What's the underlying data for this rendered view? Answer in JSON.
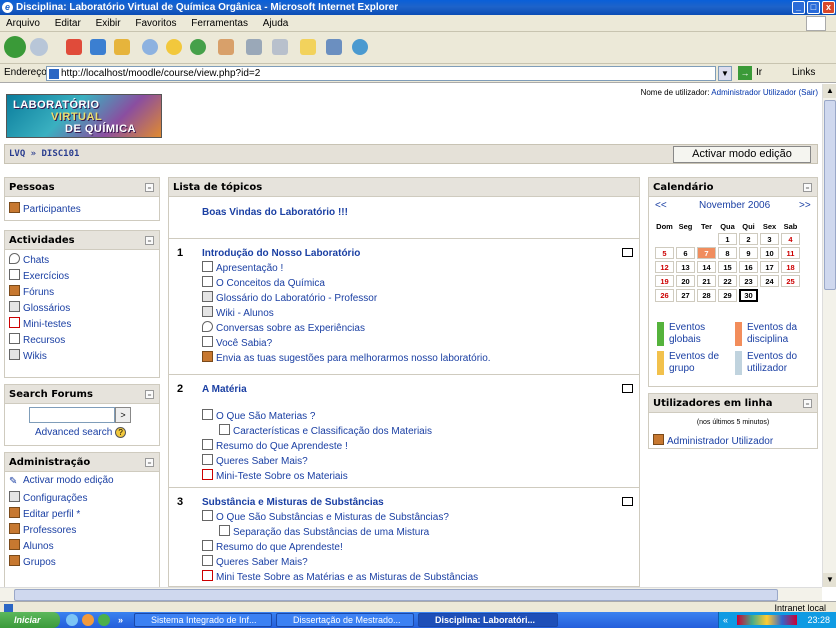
{
  "window": {
    "title": "Disciplina: Laboratório Virtual de Química Orgânica - Microsoft Internet Explorer"
  },
  "menu": [
    "Arquivo",
    "Editar",
    "Exibir",
    "Favoritos",
    "Ferramentas",
    "Ajuda"
  ],
  "address": {
    "label": "Endereço",
    "url": "http://localhost/moodle/course/view.php?id=2",
    "go": "Ir",
    "links": "Links"
  },
  "logo": {
    "line1": "LABORATÓRIO",
    "line2": "VIRTUAL",
    "line3": "DE QUÍMICA"
  },
  "login": {
    "prefix": "Nome de utilizador:",
    "user": "Administrador Utilizador",
    "logout": "(Sair)"
  },
  "nav": {
    "crumb": "LVQ » DISC101",
    "edit_button": "Activar modo edição"
  },
  "pessoas": {
    "title": "Pessoas",
    "items": [
      "Participantes"
    ]
  },
  "actividades": {
    "title": "Actividades",
    "items": [
      "Chats",
      "Exercícios",
      "Fóruns",
      "Glossários",
      "Mini-testes",
      "Recursos",
      "Wikis"
    ]
  },
  "search": {
    "title": "Search Forums",
    "button": ">",
    "advanced": "Advanced search"
  },
  "admin": {
    "title": "Administração",
    "items": [
      "Activar modo edição",
      "Configurações",
      "Editar perfil *",
      "Professores",
      "Alunos",
      "Grupos"
    ]
  },
  "topics": {
    "title": "Lista de tópicos",
    "welcome": "Boas Vindas do Laboratório !!!",
    "sections": [
      {
        "num": "1",
        "title": "Introdução do Nosso Laboratório",
        "items": [
          "Apresentação !",
          "O Conceitos da Química",
          "Glossário do Laboratório - Professor",
          "Wiki - Alunos",
          "Conversas sobre as Experiências",
          "Você Sabia?",
          "Envia as tuas sugestões para melhorarmos nosso laboratório."
        ]
      },
      {
        "num": "2",
        "title": "A Matéria",
        "items": [
          "O Que São Materias ?",
          "Características e Classificação dos Materiais",
          "Resumo do Que Aprendeste !",
          "Queres Saber Mais?",
          "Mini-Teste Sobre os Materiais"
        ]
      },
      {
        "num": "3",
        "title": "Substância e Misturas de Substâncias",
        "items": [
          "O Que São Substâncias e Misturas de Substâncias?",
          "Separação das Substâncias de uma Mistura",
          "Resumo do que Aprendeste!",
          "Queres Saber Mais?",
          "Mini Teste Sobre as Matérias e as Misturas de Substâncias"
        ]
      }
    ]
  },
  "calendar": {
    "title": "Calendário",
    "prev": "<<",
    "month": "November 2006",
    "next": ">>",
    "weekdays": [
      "Dom",
      "Seg",
      "Ter",
      "Qua",
      "Qui",
      "Sex",
      "Sab"
    ],
    "weeks": [
      [
        "",
        "",
        "",
        "1",
        "2",
        "3",
        "4"
      ],
      [
        "5",
        "6",
        "7",
        "8",
        "9",
        "10",
        "11"
      ],
      [
        "12",
        "13",
        "14",
        "15",
        "16",
        "17",
        "18"
      ],
      [
        "19",
        "20",
        "21",
        "22",
        "23",
        "24",
        "25"
      ],
      [
        "26",
        "27",
        "28",
        "29",
        "30",
        "",
        ""
      ]
    ],
    "legend": [
      "Eventos globais",
      "Eventos da disciplina",
      "Eventos de grupo",
      "Eventos do utilizador"
    ],
    "colors": {
      "global": "#55b33c",
      "course": "#f28d5b",
      "group": "#f2c14c",
      "user": "#c0d3de",
      "highlight": "#f08d5e"
    }
  },
  "online": {
    "title": "Utilizadores em linha",
    "subtitle": "(nos últimos 5 minutos)",
    "user": "Administrador Utilizador"
  },
  "status": {
    "zone": "Intranet local"
  },
  "taskbar": {
    "start": "Iniciar",
    "tasks": [
      "Sistema Integrado de Inf...",
      "Dissertação de Mestrado...",
      "Disciplina: Laboratóri..."
    ],
    "clock": "23:28"
  }
}
